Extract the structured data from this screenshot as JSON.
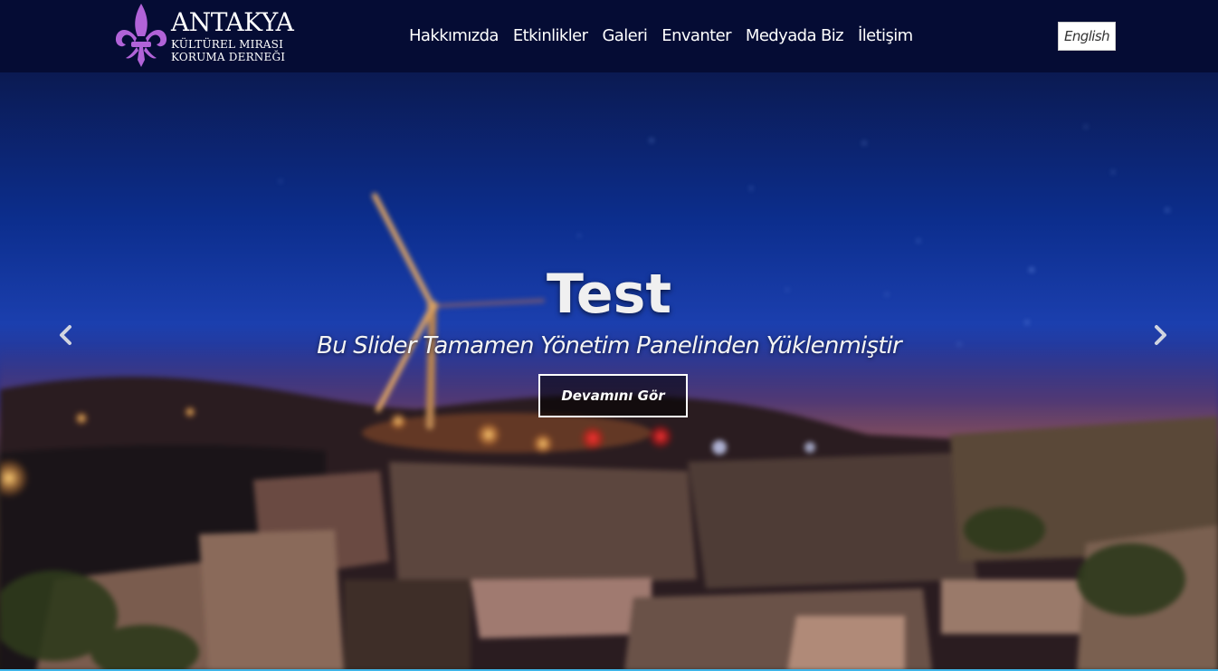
{
  "brand": {
    "title": "ANTAKYA",
    "subtitle_line1": "KÜLTÜREL MIRASI",
    "subtitle_line2": "KORUMA DERNEĞI",
    "logo_icon": "fleur-de-lis-icon",
    "logo_color": "#b163d8"
  },
  "nav": {
    "items": [
      {
        "label": "Hakkımızda"
      },
      {
        "label": "Etkinlikler"
      },
      {
        "label": "Galeri"
      },
      {
        "label": "Envanter"
      },
      {
        "label": "Medyada Biz"
      },
      {
        "label": "İletişim"
      }
    ],
    "language_button": "English"
  },
  "slider": {
    "title": "Test",
    "subtitle": "Bu Slider Tamamen Yönetim Panelinden Yüklenmiştir",
    "button_label": "Devamını Gör",
    "prev_icon": "chevron-left-icon",
    "next_icon": "chevron-right-icon"
  },
  "colors": {
    "navbar_bg": "#050c34",
    "accent_line": "#3fb5e8"
  }
}
